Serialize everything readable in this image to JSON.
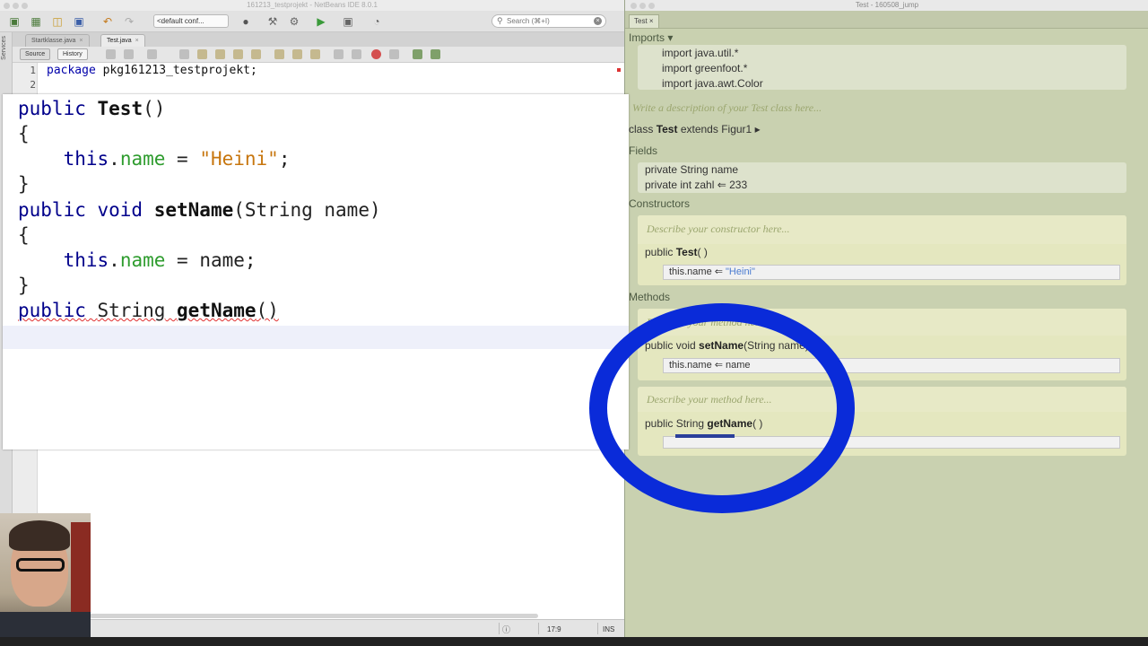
{
  "netbeans": {
    "window_title": "161213_testprojekt - NetBeans IDE 8.0.1",
    "config_select": "<default conf...",
    "search_placeholder": "Search (⌘+I)",
    "side_label": "Services",
    "tabs": [
      {
        "label": "Startklasse.java",
        "active": false
      },
      {
        "label": "Test.java",
        "active": true
      }
    ],
    "editor_modes": {
      "source": "Source",
      "history": "History"
    },
    "code_lines": [
      {
        "num": "1",
        "keyword": "package",
        "rest": " pkg161213_testprojekt;"
      },
      {
        "num": "2",
        "keyword": "",
        "rest": ""
      }
    ],
    "status": {
      "position": "17:9",
      "mode": "INS"
    }
  },
  "zoom": {
    "lines": [
      {
        "kw": "public",
        "name": "Test",
        "rest": "()"
      },
      {
        "text": "{"
      },
      {
        "this": "this",
        "field": "name",
        "op": " = ",
        "str": "\"Heini\"",
        "end": ";"
      },
      {
        "text": "}"
      },
      {
        "kw": "public void",
        "name": "setName",
        "rest": "(String name)"
      },
      {
        "text": "{"
      },
      {
        "this": "this",
        "field": "name",
        "op": " = ",
        "str": "name",
        "end": ";"
      },
      {
        "text": "}"
      },
      {
        "kw": "public",
        "type": "String",
        "name": "getName",
        "rest": "()"
      }
    ]
  },
  "greenfoot": {
    "window_title": "Test - 160508_jump",
    "tab_label": "Test",
    "imports_header": "Imports",
    "imports": [
      {
        "kw": "import",
        "pkg": "java.util.*"
      },
      {
        "kw": "import",
        "pkg": "greenfoot.*"
      },
      {
        "kw": "import",
        "pkg": "java.awt.Color"
      }
    ],
    "class_description": "Write a description of your Test class here...",
    "class_decl": {
      "kw": "class",
      "name": "Test",
      "extends_kw": "extends",
      "parent": "Figur1"
    },
    "fields_header": "Fields",
    "fields": [
      "private String name",
      "private int zahl ⇐ 233"
    ],
    "constructors_header": "Constructors",
    "constructor": {
      "description": "Describe your constructor here...",
      "signature_kw": "public",
      "name": "Test",
      "params": "( )",
      "body_lhs": "this.name ⇐ ",
      "body_rhs": "\"Heini\""
    },
    "methods_header": "Methods",
    "methods": [
      {
        "description": "Describe your method here...",
        "signature_kw": "public void",
        "name": "setName",
        "params": "(String name)",
        "body": "this.name ⇐ name"
      },
      {
        "description": "Describe your method here...",
        "signature_kw": "public String",
        "name": "getName",
        "params": "( )",
        "body": ""
      }
    ]
  },
  "colors": {
    "annotation_circle": "#0a2bd9",
    "keyword": "#00008b",
    "field": "#2e9c2e",
    "string": "#c7760e"
  }
}
